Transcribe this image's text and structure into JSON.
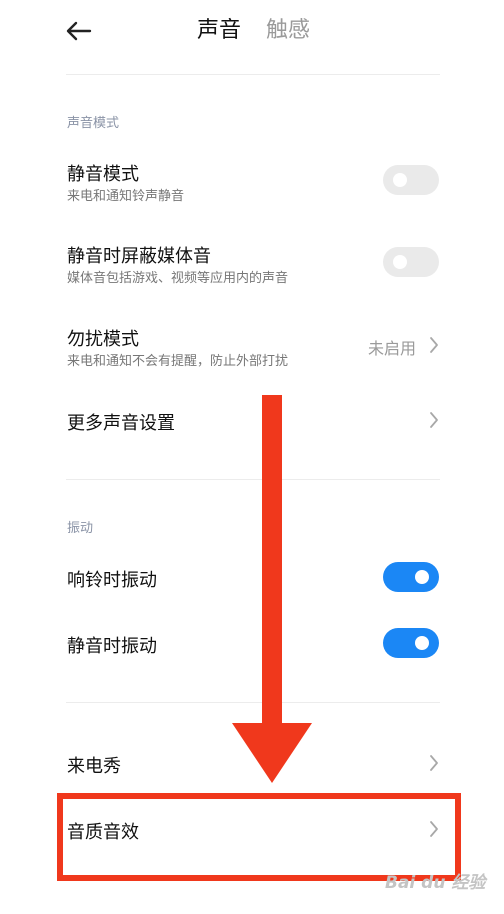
{
  "header": {
    "tabs": [
      {
        "label": "声音",
        "active": true
      },
      {
        "label": "触感",
        "active": false
      }
    ],
    "back_icon": "arrow-left-icon"
  },
  "sections": {
    "sound_mode": {
      "header": "声音模式",
      "rows": [
        {
          "title": "静音模式",
          "subtitle": "来电和通知铃声静音",
          "control": "toggle",
          "on": false
        },
        {
          "title": "静音时屏蔽媒体音",
          "subtitle": "媒体音包括游戏、视频等应用内的声音",
          "control": "toggle",
          "on": false
        },
        {
          "title": "勿扰模式",
          "subtitle": "来电和通知不会有提醒，防止外部打扰",
          "control": "chevron",
          "value": "未启用"
        },
        {
          "title": "更多声音设置",
          "control": "chevron"
        }
      ]
    },
    "vibration": {
      "header": "振动",
      "rows": [
        {
          "title": "响铃时振动",
          "control": "toggle",
          "on": true
        },
        {
          "title": "静音时振动",
          "control": "toggle",
          "on": true
        }
      ]
    },
    "other": {
      "rows": [
        {
          "title": "来电秀",
          "control": "chevron"
        },
        {
          "title": "音质音效",
          "control": "chevron"
        }
      ]
    }
  },
  "colors": {
    "accent": "#1b87f5",
    "annotation": "#f0381c",
    "toggle_off": "#eaeaea"
  },
  "watermark": "Bai du 经验"
}
